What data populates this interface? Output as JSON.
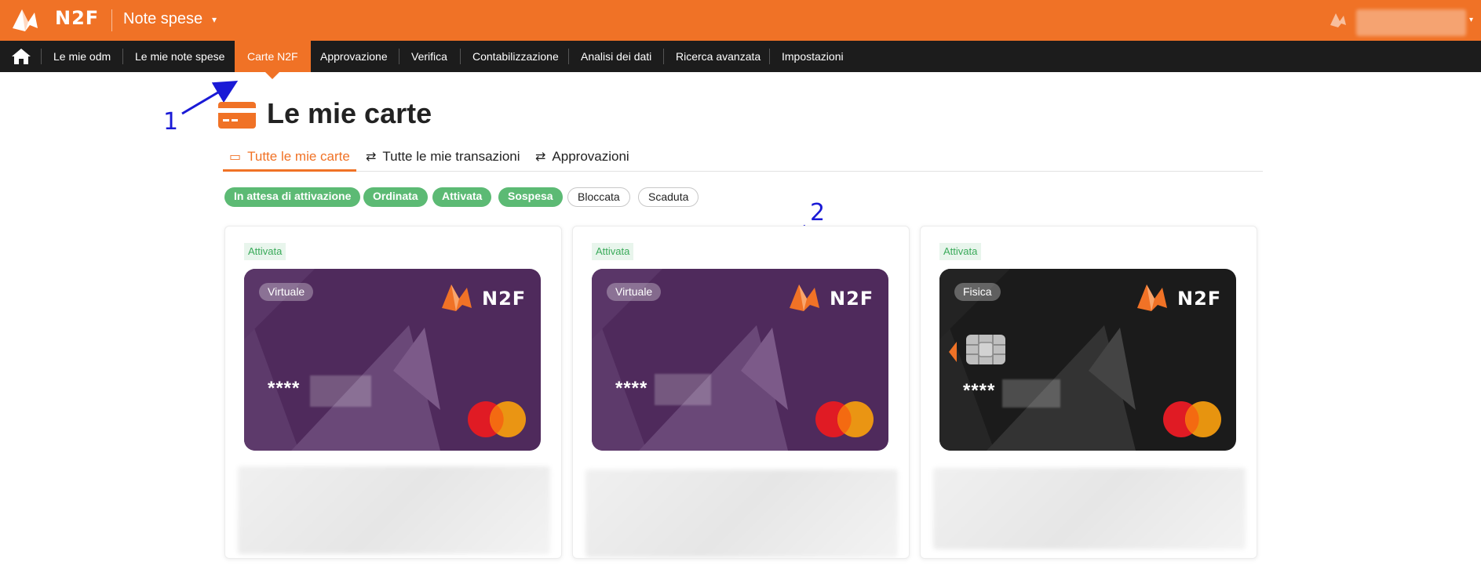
{
  "colors": {
    "brand": "#f07226",
    "nav_bg": "#1c1c1c",
    "status_green": "#5cba74",
    "card_purple": "#4f2a5c",
    "card_black": "#1b1b1b"
  },
  "header": {
    "logo_text": "N2F",
    "app_title": "Note spese",
    "caret": "▾",
    "user_caret": "▾"
  },
  "nav": {
    "home_icon": "home-icon",
    "items": [
      {
        "label": "Le mie odm"
      },
      {
        "label": "Le mie note spese"
      },
      {
        "label": "Carte N2F",
        "active": true
      },
      {
        "label": "Approvazione"
      },
      {
        "label": "Verifica"
      },
      {
        "label": "Contabilizzazione"
      },
      {
        "label": "Analisi dei dati"
      },
      {
        "label": "Ricerca avanzata"
      },
      {
        "label": "Impostazioni"
      }
    ]
  },
  "annotations": [
    "1",
    "2"
  ],
  "page": {
    "title": "Le mie carte",
    "icon": "credit-card-icon"
  },
  "tabs": [
    {
      "label": "Tutte le mie carte",
      "icon": "card-icon",
      "active": true
    },
    {
      "label": "Tutte le mie transazioni",
      "icon": "transfer-icon"
    },
    {
      "label": "Approvazioni",
      "icon": "transfer-icon"
    }
  ],
  "filters": [
    {
      "label": "In attesa di attivazione",
      "style": "green"
    },
    {
      "label": "Ordinata",
      "style": "green"
    },
    {
      "label": "Attivata",
      "style": "green"
    },
    {
      "label": "Sospesa",
      "style": "green"
    },
    {
      "label": "Bloccata",
      "style": "outline"
    },
    {
      "label": "Scaduta",
      "style": "outline"
    }
  ],
  "cards": [
    {
      "status": "Attivata",
      "type": "Virtuale",
      "brand": "N2F",
      "number_mask": "****",
      "variant": "purple"
    },
    {
      "status": "Attivata",
      "type": "Virtuale",
      "brand": "N2F",
      "number_mask": "****",
      "variant": "purple"
    },
    {
      "status": "Attivata",
      "type": "Fisica",
      "brand": "N2F",
      "number_mask": "****",
      "variant": "black"
    }
  ]
}
